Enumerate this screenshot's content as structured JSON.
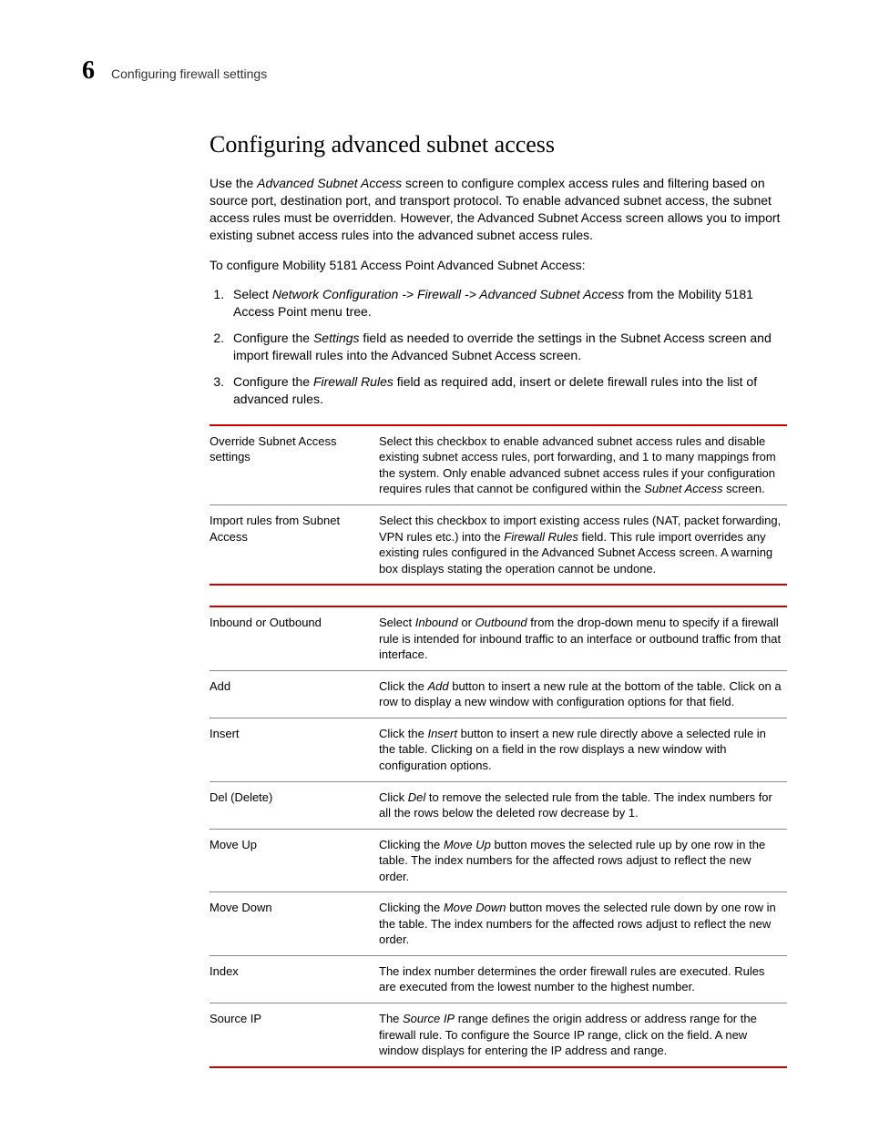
{
  "header": {
    "chapterNumber": "6",
    "chapterTitle": "Configuring firewall settings"
  },
  "section": {
    "title": "Configuring advanced subnet access",
    "intro": "Use the Advanced Subnet Access screen to configure complex access rules and filtering based on source port, destination port, and transport protocol. To enable advanced subnet access, the subnet access rules must be overridden. However, the Advanced Subnet Access screen allows you to import existing subnet access rules into the advanced subnet access rules.",
    "lead": "To configure Mobility 5181 Access Point Advanced Subnet Access:",
    "steps": [
      "Select Network Configuration -> Firewall -> Advanced Subnet Access from the Mobility 5181 Access Point menu tree.",
      "Configure the Settings field as needed to override the settings in the Subnet Access screen and import firewall rules into the Advanced Subnet Access screen.",
      "Configure the Firewall Rules field as required add, insert or delete firewall rules into the list of advanced rules."
    ]
  },
  "table1": [
    {
      "term": "Override Subnet Access settings",
      "desc": "Select this checkbox to enable advanced subnet access rules and disable existing subnet access rules, port forwarding, and 1 to many mappings from the system. Only enable advanced subnet access rules if your configuration requires rules that cannot be configured within the Subnet Access screen."
    },
    {
      "term": "Import rules from Subnet Access",
      "desc": "Select this checkbox to import existing access rules (NAT, packet forwarding, VPN rules etc.) into the Firewall Rules field. This rule import overrides any existing rules configured in the Advanced Subnet Access screen. A warning box displays stating the operation cannot be undone."
    }
  ],
  "table2": [
    {
      "term": "Inbound or Outbound",
      "desc": "Select Inbound or Outbound from the drop-down menu to specify if a firewall rule is intended for inbound traffic to an interface or outbound traffic from that interface."
    },
    {
      "term": "Add",
      "desc": "Click the Add button to insert a new rule at the bottom of the table. Click on a row to display a new window with configuration options for that field."
    },
    {
      "term": "Insert",
      "desc": "Click the Insert button to insert a new rule directly above a selected rule in the table. Clicking on a field in the row displays a new window with configuration options."
    },
    {
      "term": "Del (Delete)",
      "desc": "Click Del to remove the selected rule from the table. The index numbers for all the rows below the deleted row decrease by 1."
    },
    {
      "term": "Move Up",
      "desc": "Clicking the Move Up button moves the selected rule up by one row in the table. The index numbers for the affected rows adjust to reflect the new order."
    },
    {
      "term": "Move Down",
      "desc": "Clicking the Move Down button moves the selected rule down by one row in the table. The index numbers for the affected rows adjust to reflect the new order."
    },
    {
      "term": "Index",
      "desc": "The index number determines the order firewall rules are executed. Rules are executed from the lowest number to the highest number."
    },
    {
      "term": "Source IP",
      "desc": "The Source IP range defines the origin address or address range for the firewall rule. To configure the Source IP range, click on the field. A new window displays for entering the IP address and range."
    }
  ]
}
